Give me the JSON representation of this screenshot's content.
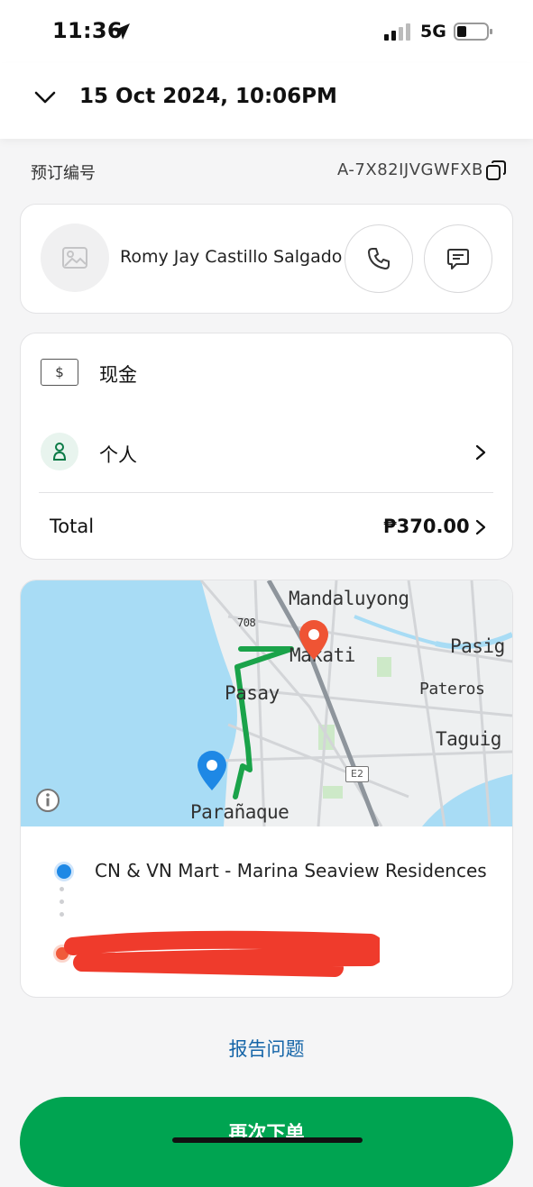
{
  "status_bar": {
    "time": "11:36",
    "network": "5G"
  },
  "header": {
    "title": "15 Oct 2024, 10:06PM"
  },
  "booking": {
    "label": "预订编号",
    "code": "A-7X82IJVGWFXB"
  },
  "driver": {
    "name": "Romy Jay Castillo Salgado"
  },
  "payment": {
    "method_label": "现金",
    "cash_symbol": "$",
    "profile_label": "个人",
    "total_label": "Total",
    "total_value": "₱370.00"
  },
  "map": {
    "labels": {
      "mandaluyong": "Mandaluyong",
      "makati": "Makati",
      "pasig": "Pasig",
      "pasay": "Pasay",
      "pateros": "Pateros",
      "taguig": "Taguig",
      "paranaque": "Parañaque",
      "road_708": "708",
      "road_e2": "E2"
    },
    "route_color": "#1aa34a",
    "pickup_color": "#1e88e5",
    "dropoff_color": "#ef5434"
  },
  "trip": {
    "pickup": "CN & VN Mart - Marina Seaview Residences",
    "dropoff": ""
  },
  "actions": {
    "report": "报告问题",
    "reorder": "再次下单"
  }
}
